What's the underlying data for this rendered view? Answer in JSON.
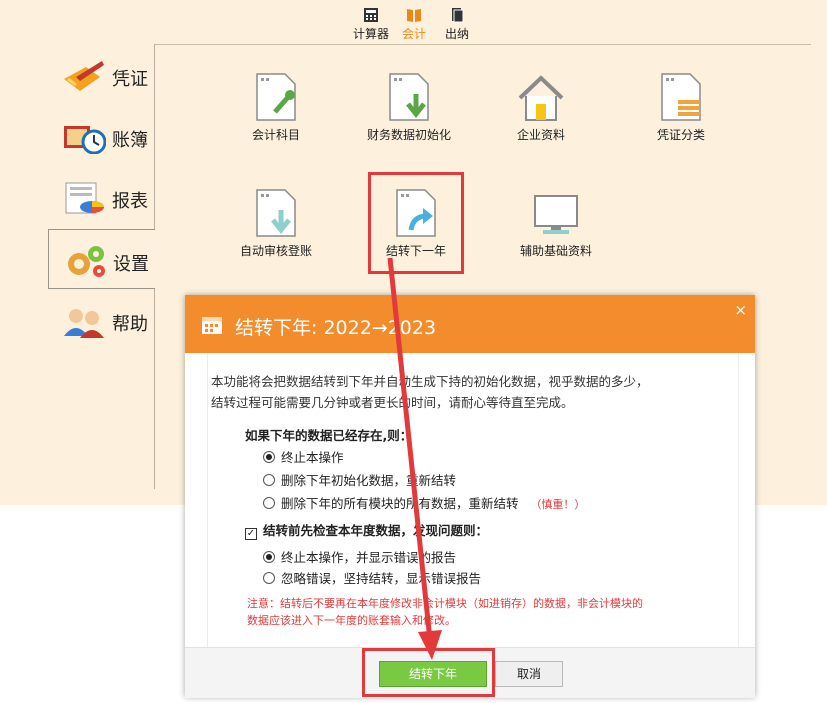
{
  "top_tabs": [
    {
      "label": "计算器",
      "icon": "calculator-icon"
    },
    {
      "label": "会计",
      "icon": "book-icon",
      "active": true
    },
    {
      "label": "出纳",
      "icon": "cashier-icon"
    }
  ],
  "nav": [
    {
      "label": "凭证",
      "icon": "voucher-pen-icon"
    },
    {
      "label": "账簿",
      "icon": "ledger-clock-icon"
    },
    {
      "label": "报表",
      "icon": "report-chart-icon"
    },
    {
      "label": "设置",
      "icon": "gears-icon",
      "selected": true
    },
    {
      "label": "帮助",
      "icon": "help-people-icon"
    }
  ],
  "grid": [
    {
      "label": "会计科目",
      "icon": "doc-wrench-icon"
    },
    {
      "label": "财务数据初始化",
      "icon": "doc-download-icon"
    },
    {
      "label": "企业资料",
      "icon": "house-icon"
    },
    {
      "label": "凭证分类",
      "icon": "doc-stack-icon"
    },
    {
      "label": "自动审核登账",
      "icon": "doc-down-arrow-icon"
    },
    {
      "label": "结转下一年",
      "icon": "doc-forward-arrow-icon"
    },
    {
      "label": "辅助基础资料",
      "icon": "monitor-icon"
    }
  ],
  "dialog": {
    "title": "结转下年:  2022→2023",
    "close": "×",
    "desc_line1": "本功能将会把数据结转到下年并自动生成下持的初始化数据，视乎数据的多少，",
    "desc_line2": "结转过程可能需要几分钟或者更长的时间，请耐心等待直至完成。",
    "section1": "如果下年的数据已经存在,则：",
    "options1": [
      {
        "label": "终止本操作",
        "checked": true
      },
      {
        "label": "删除下年初始化数据，重新结转",
        "checked": false
      },
      {
        "label": "删除下年的所有模块的所有数据，重新结转",
        "checked": false,
        "warn": "（慎重！）"
      }
    ],
    "section2": "结转前先检查本年度数据，发现问题则：",
    "section2_checked": true,
    "options2": [
      {
        "label": "终止本操作，并显示错误的报告",
        "checked": true
      },
      {
        "label": "忽略错误，坚持结转，显示错误报告",
        "checked": false
      }
    ],
    "note_line1": "注意：结转后不要再在本年度修改非会计模块（如进销存）的数据，非会计模块的",
    "note_line2": "数据应该进入下一年度的账套输入和修改。",
    "ok_label": "结转下年",
    "cancel_label": "取消"
  },
  "colors": {
    "accent": "#f28c2c",
    "highlight": "#e23a3a",
    "ok_button": "#7ac943"
  }
}
